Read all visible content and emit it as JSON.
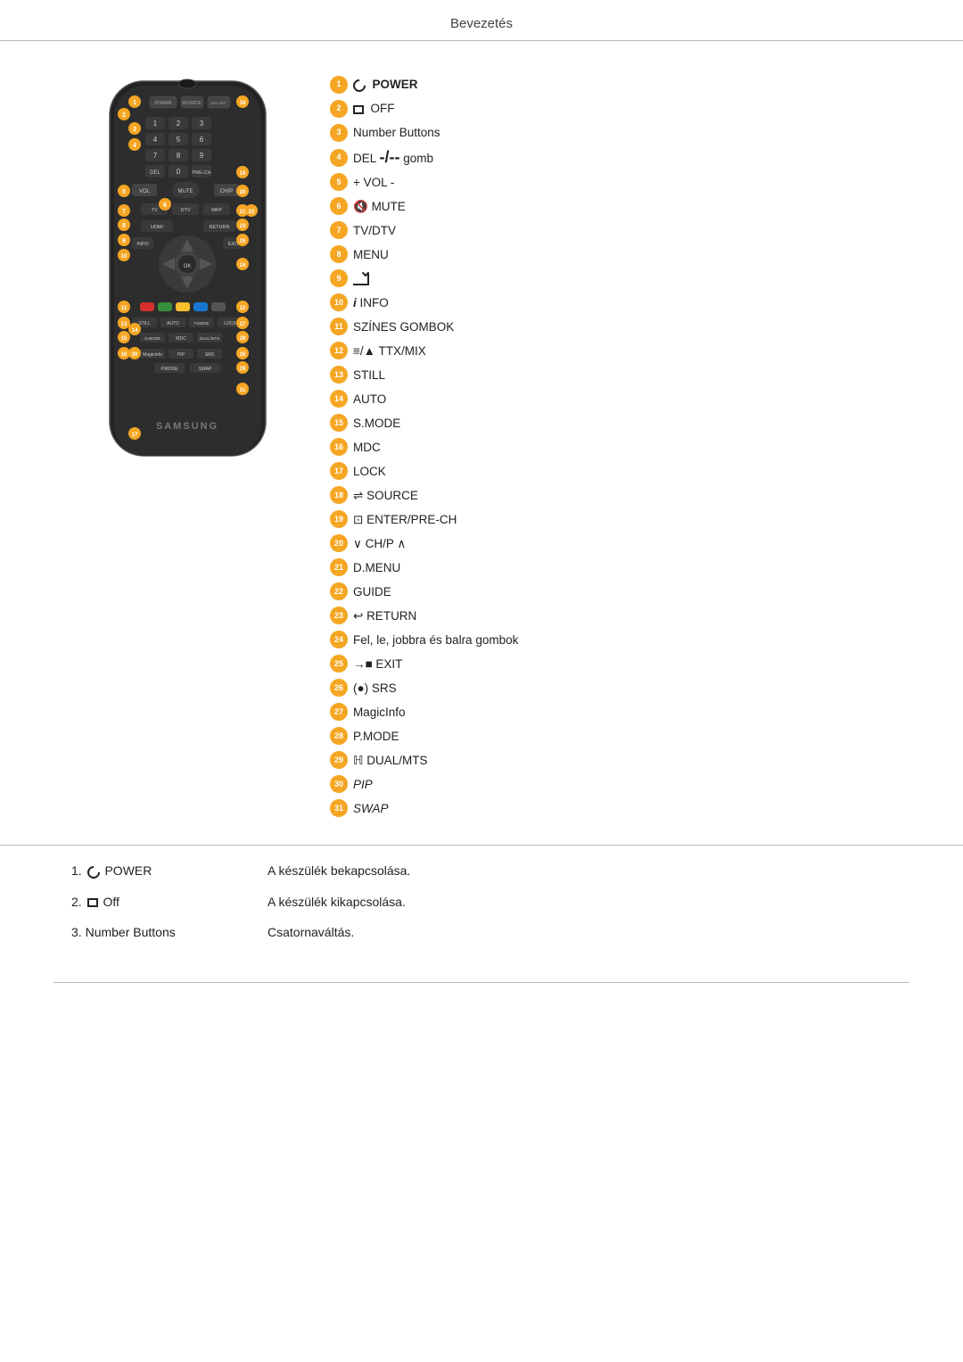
{
  "header": {
    "title": "Bevezetés"
  },
  "legend": [
    {
      "num": "1",
      "icon": "power",
      "text": "POWER"
    },
    {
      "num": "2",
      "icon": "off",
      "text": "OFF"
    },
    {
      "num": "3",
      "icon": "",
      "text": "Number Buttons"
    },
    {
      "num": "4",
      "icon": "del",
      "text": "DEL -/-- gomb"
    },
    {
      "num": "5",
      "icon": "",
      "text": "+ VOL -"
    },
    {
      "num": "6",
      "icon": "mute",
      "text": "MUTE"
    },
    {
      "num": "7",
      "icon": "",
      "text": "TV/DTV"
    },
    {
      "num": "8",
      "icon": "",
      "text": "MENU"
    },
    {
      "num": "9",
      "icon": "enter",
      "text": ""
    },
    {
      "num": "10",
      "icon": "info",
      "text": "INFO"
    },
    {
      "num": "11",
      "icon": "",
      "text": "SZÍNES GOMBOK"
    },
    {
      "num": "12",
      "icon": "ttx",
      "text": "TTX/MIX"
    },
    {
      "num": "13",
      "icon": "",
      "text": "STILL"
    },
    {
      "num": "14",
      "icon": "",
      "text": "AUTO"
    },
    {
      "num": "15",
      "icon": "",
      "text": "S.MODE"
    },
    {
      "num": "16",
      "icon": "",
      "text": "MDC"
    },
    {
      "num": "17",
      "icon": "",
      "text": "LOCK"
    },
    {
      "num": "18",
      "icon": "source",
      "text": "SOURCE"
    },
    {
      "num": "19",
      "icon": "enter2",
      "text": "ENTER/PRE-CH"
    },
    {
      "num": "20",
      "icon": "",
      "text": "∨ CH/P ∧"
    },
    {
      "num": "21",
      "icon": "",
      "text": "D.MENU"
    },
    {
      "num": "22",
      "icon": "",
      "text": "GUIDE"
    },
    {
      "num": "23",
      "icon": "return",
      "text": "RETURN"
    },
    {
      "num": "24",
      "icon": "",
      "text": "Fel, le, jobbra és balra gombok"
    },
    {
      "num": "25",
      "icon": "exit",
      "text": "EXIT"
    },
    {
      "num": "26",
      "icon": "srs",
      "text": "SRS"
    },
    {
      "num": "27",
      "icon": "",
      "text": "MagicInfo"
    },
    {
      "num": "28",
      "icon": "",
      "text": "P.MODE"
    },
    {
      "num": "29",
      "icon": "dual",
      "text": "DUAL/MTS"
    },
    {
      "num": "30",
      "icon": "",
      "text": "PIP",
      "italic": true
    },
    {
      "num": "31",
      "icon": "",
      "text": "SWAP",
      "italic": true
    }
  ],
  "descriptions": [
    {
      "num": "1.",
      "label_icon": "power",
      "label": "POWER",
      "desc": "A készülék bekapcsolása."
    },
    {
      "num": "2.",
      "label_icon": "off",
      "label": "Off",
      "desc": "A készülék kikapcsolása."
    },
    {
      "num": "3.",
      "label": "Number Buttons",
      "desc": "Csatornaváltás."
    }
  ],
  "remote": {
    "brand": "SAMSUNG"
  }
}
